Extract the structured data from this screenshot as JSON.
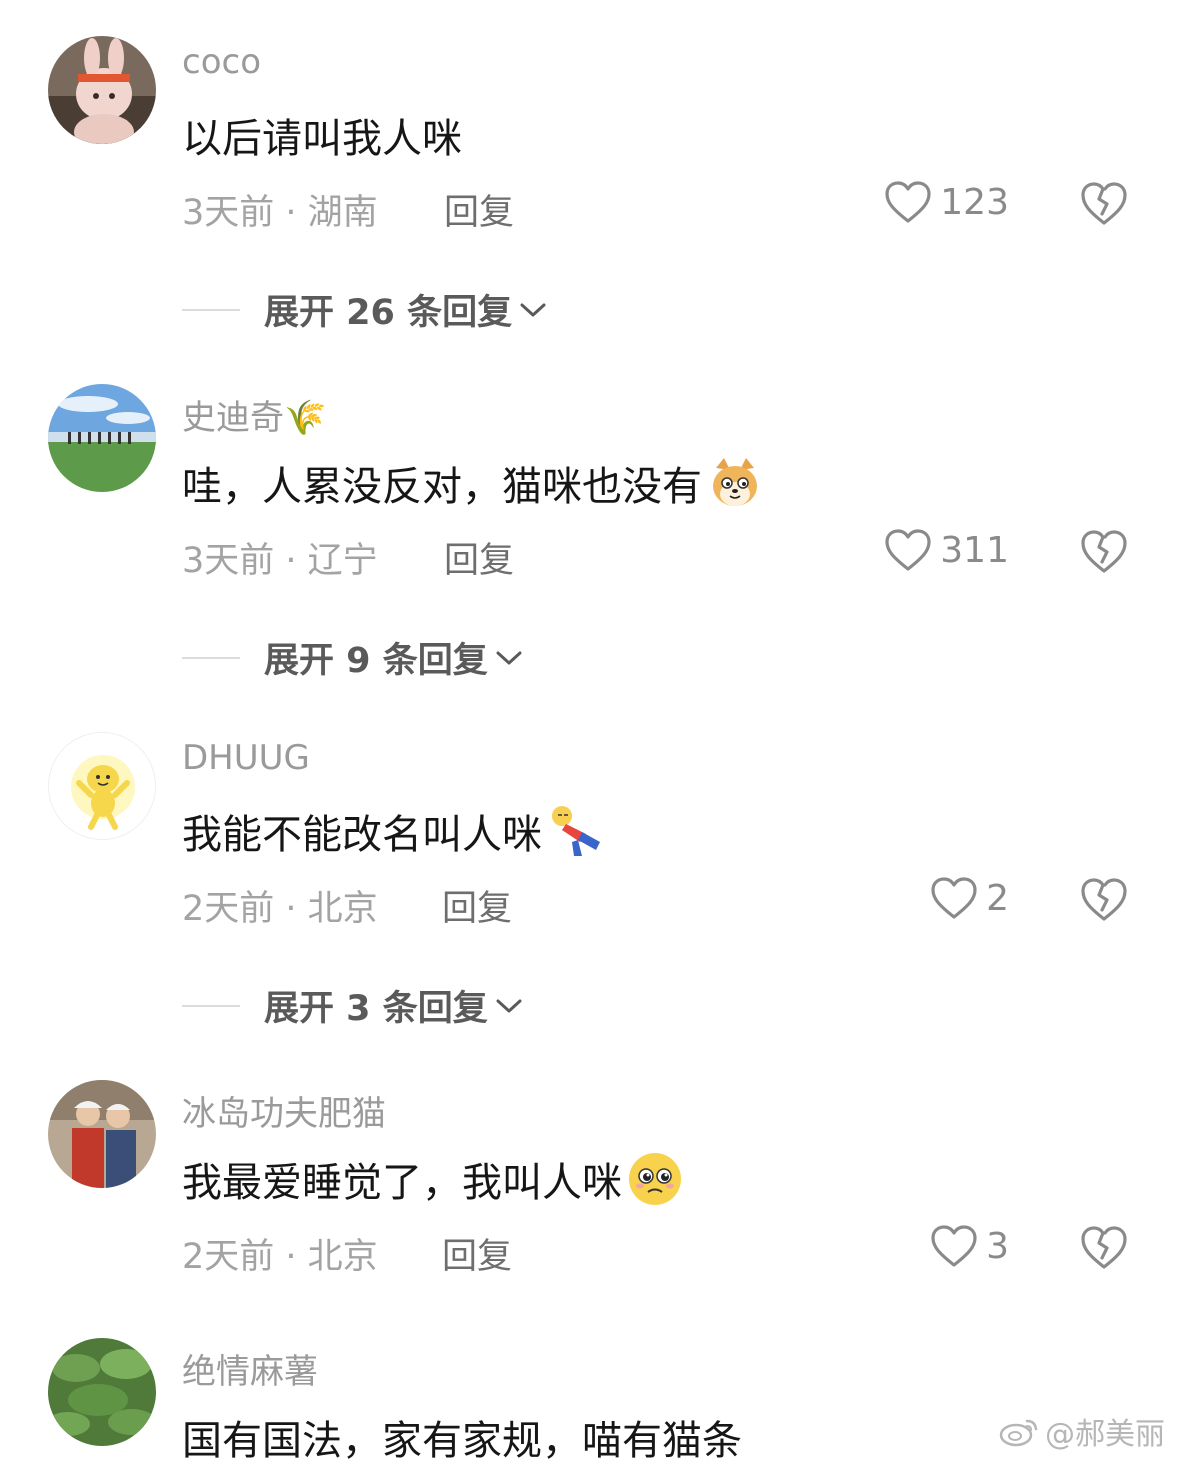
{
  "comments": [
    {
      "username": "coco",
      "content": "以后请叫我人咪",
      "meta": "3天前 · 湖南",
      "reply_label": "回复",
      "likes": "123",
      "expand_label": "展开 26 条回复"
    },
    {
      "username": "史迪奇🌾",
      "content": "哇，人累没反对，猫咪也没有",
      "meta": "3天前 · 辽宁",
      "reply_label": "回复",
      "likes": "311",
      "expand_label": "展开 9 条回复"
    },
    {
      "username": "DHUUG",
      "content": "我能不能改名叫人咪",
      "meta": "2天前 · 北京",
      "reply_label": "回复",
      "likes": "2",
      "expand_label": "展开 3 条回复"
    },
    {
      "username": "冰岛功夫肥猫",
      "content": "我最爱睡觉了，我叫人咪",
      "meta": "2天前 · 北京",
      "reply_label": "回复",
      "likes": "3"
    },
    {
      "username": "绝情麻薯",
      "content": "国有国法，家有家规，喵有猫条"
    }
  ],
  "watermark": "@郝美丽",
  "icons": {
    "like": "heart-outline-icon",
    "dislike": "broken-heart-icon",
    "expand": "chevron-down-icon",
    "watermark": "weibo-logo-icon"
  },
  "colors": {
    "username": "#9a9a9a",
    "content": "#161616",
    "meta": "#a3a3a3"
  }
}
